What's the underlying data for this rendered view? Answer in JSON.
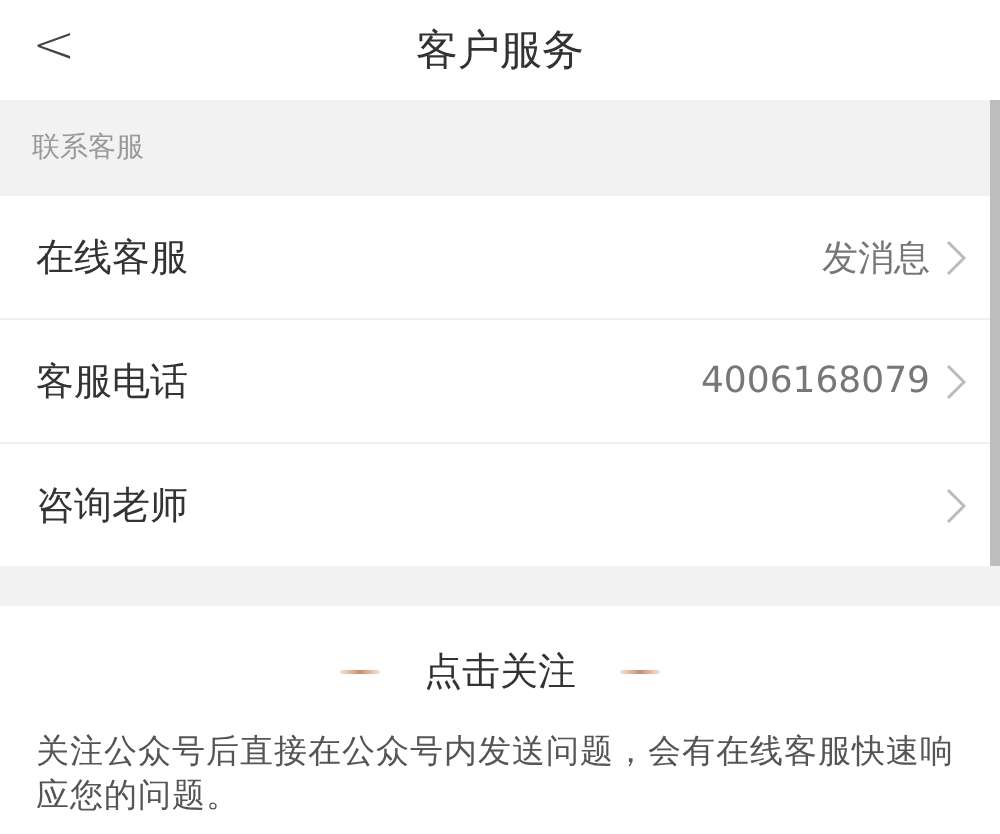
{
  "header": {
    "back": "<",
    "title": "客户服务"
  },
  "section": {
    "label": "联系客服"
  },
  "rows": [
    {
      "label": "在线客服",
      "value": "发消息"
    },
    {
      "label": "客服电话",
      "value": "4006168079"
    },
    {
      "label": "咨询老师"
    }
  ],
  "follow": {
    "title": "点击关注",
    "description": "关注公众号后直接在公众号内发送问题，会有在线客服快速响应您的问题。"
  }
}
